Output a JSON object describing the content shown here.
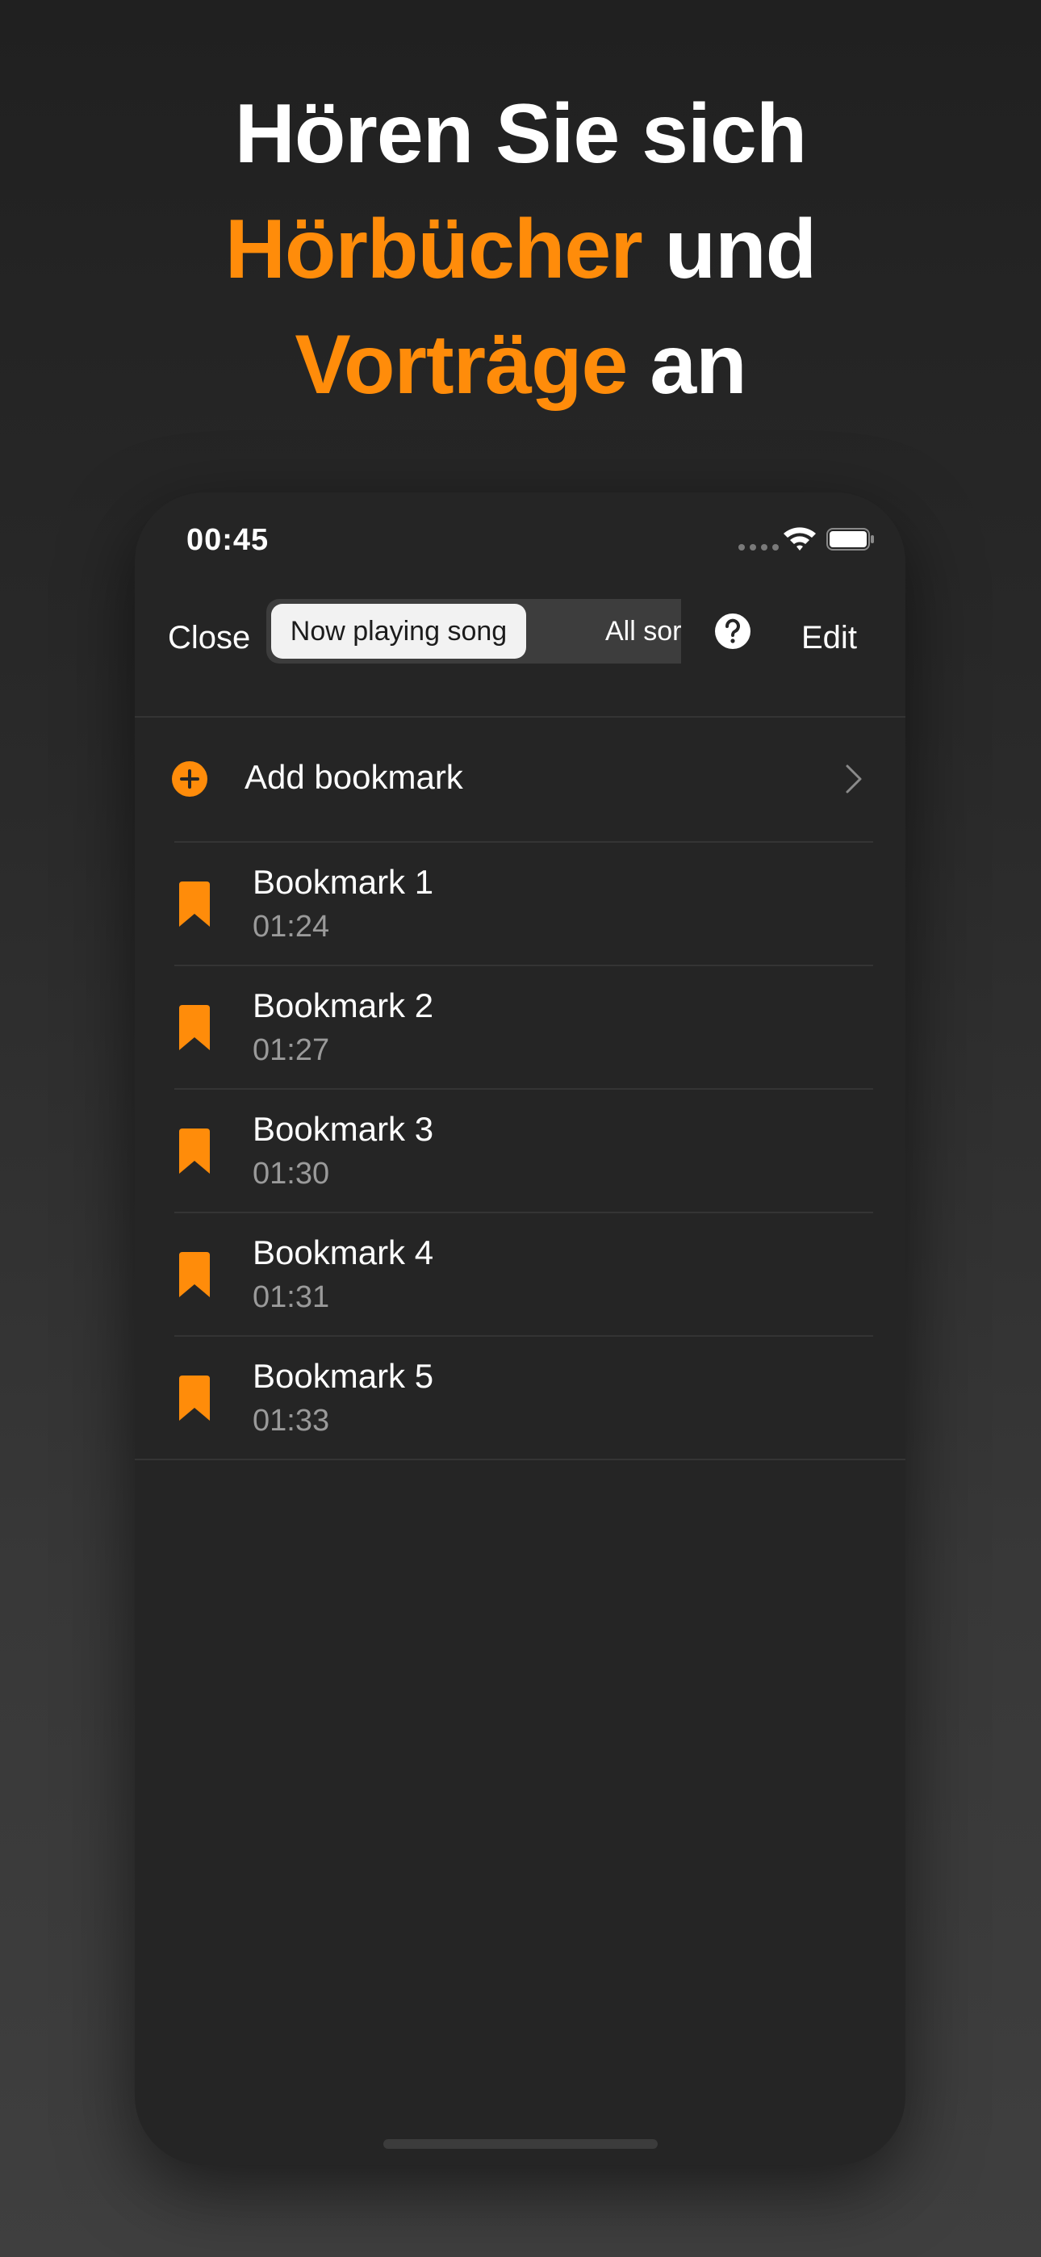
{
  "headline": {
    "line1": "Hören Sie sich",
    "line2_highlight": "Hörbücher",
    "line2_rest": " und",
    "line3_highlight": "Vorträge",
    "line3_rest": " an"
  },
  "colors": {
    "accent": "#ff8c0a",
    "background": "#252525",
    "secondary_text": "#9a9a9a"
  },
  "status_bar": {
    "time": "00:45",
    "icons": [
      "signal-dots-icon",
      "wifi-icon",
      "battery-icon"
    ]
  },
  "nav": {
    "close_label": "Close",
    "segments": [
      {
        "label": "Now playing song",
        "selected": true
      },
      {
        "label": "All songs",
        "visible_label": "All sor",
        "selected": false
      }
    ],
    "help_icon": "question-circle-icon",
    "edit_label": "Edit"
  },
  "list": {
    "add_bookmark": {
      "label": "Add bookmark",
      "icon": "plus-circle-icon",
      "trailing_icon": "chevron-right-icon"
    },
    "bookmarks": [
      {
        "title": "Bookmark 1",
        "time": "01:24",
        "icon": "bookmark-icon"
      },
      {
        "title": "Bookmark 2",
        "time": "01:27",
        "icon": "bookmark-icon"
      },
      {
        "title": "Bookmark 3",
        "time": "01:30",
        "icon": "bookmark-icon"
      },
      {
        "title": "Bookmark 4",
        "time": "01:31",
        "icon": "bookmark-icon"
      },
      {
        "title": "Bookmark 5",
        "time": "01:33",
        "icon": "bookmark-icon"
      }
    ]
  }
}
